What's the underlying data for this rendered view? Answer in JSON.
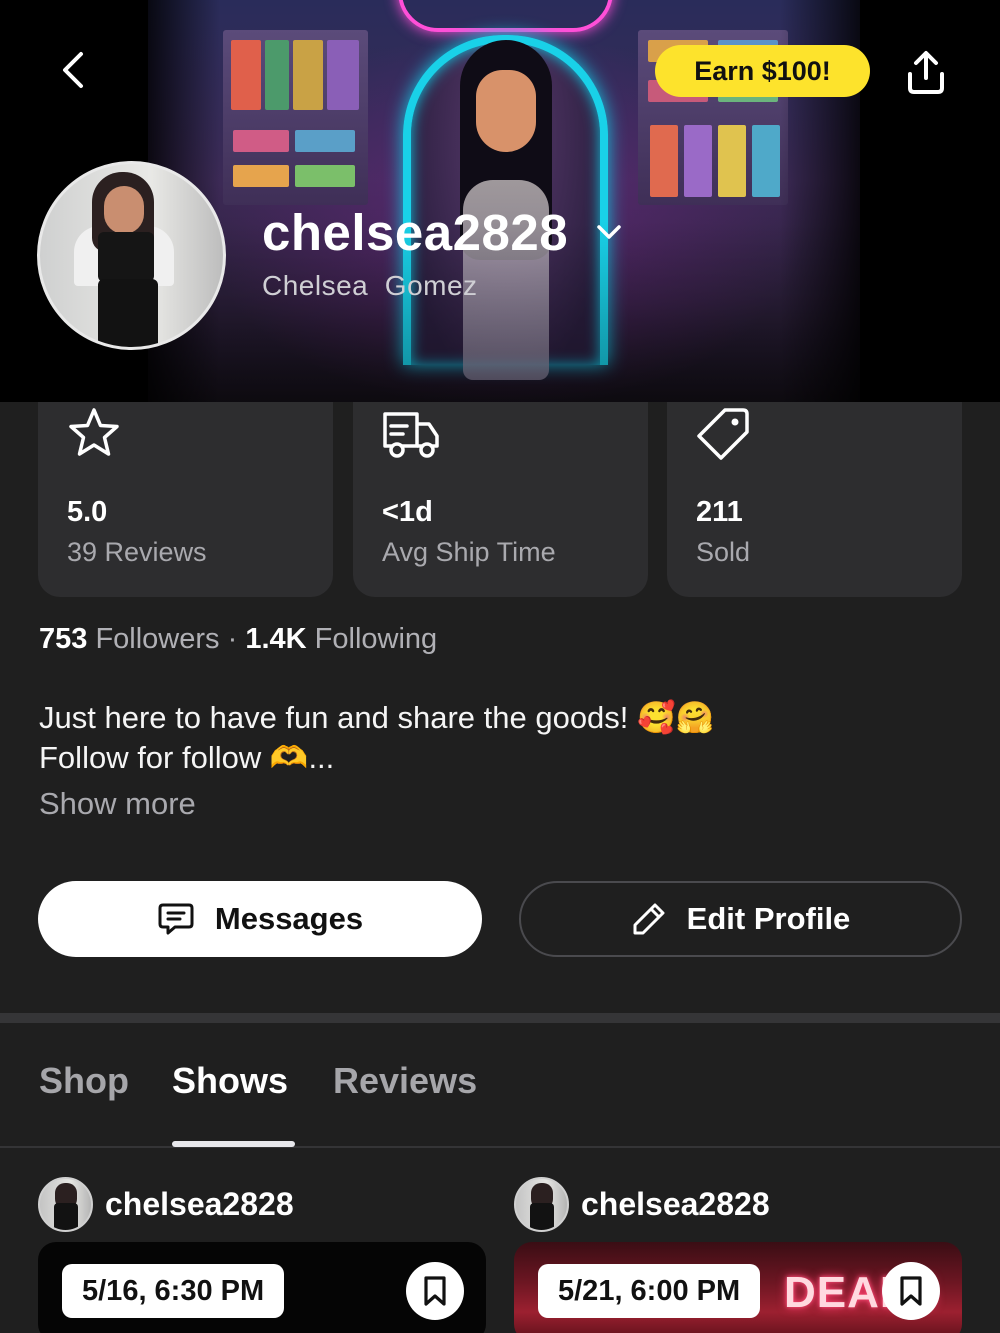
{
  "header": {
    "earn_label": "Earn $100!",
    "username": "chelsea2828",
    "full_name": "Chelsea  Gomez"
  },
  "stats": {
    "rating": {
      "value": "5.0",
      "label": "39 Reviews",
      "icon": "star-icon"
    },
    "shipping": {
      "value": "<1d",
      "label": "Avg Ship Time",
      "icon": "truck-icon"
    },
    "sold": {
      "value": "211",
      "label": "Sold",
      "icon": "tag-icon"
    }
  },
  "social": {
    "followers_count": "753",
    "followers_label": "Followers",
    "separator": "·",
    "following_count": "1.4K",
    "following_label": "Following"
  },
  "bio": {
    "line1": "Just here to have fun and share the goods! 🥰🤗",
    "line2": "Follow for follow 🫶...",
    "show_more": "Show more"
  },
  "actions": {
    "messages_label": "Messages",
    "edit_label": "Edit Profile"
  },
  "tabs": {
    "items": [
      {
        "label": "Shop"
      },
      {
        "label": "Shows"
      },
      {
        "label": "Reviews"
      }
    ],
    "selected": "Shows"
  },
  "shows": [
    {
      "username": "chelsea2828",
      "date": "5/16, 6:30 PM"
    },
    {
      "username": "chelsea2828",
      "date": "5/21, 6:00 PM",
      "banner_text": "DEALS"
    }
  ],
  "colors": {
    "background": "#1f1f1f",
    "card": "#2d2d2f",
    "earn_pill": "#fde32c",
    "muted_text": "#a9a9ae"
  }
}
